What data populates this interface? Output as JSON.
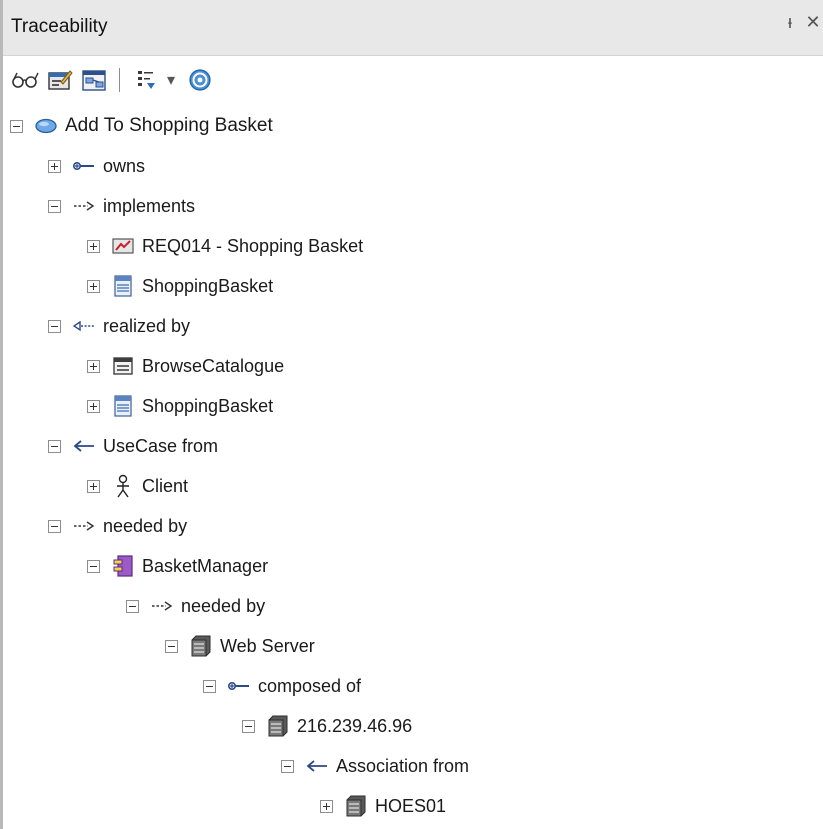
{
  "window": {
    "title": "Traceability",
    "pin_glyph": "ᵼ",
    "close_glyph": "✕"
  },
  "toolbar": {
    "icons": [
      "glasses-icon",
      "properties-icon",
      "diagram-icon",
      "filter-icon",
      "dropdown-arrow-icon",
      "help-icon"
    ],
    "dropdown_glyph": "▾"
  },
  "tree": {
    "root": {
      "label": "Add To Shopping Basket",
      "icon": "usecase-icon",
      "expanded": true
    },
    "nodes": [
      {
        "label": "owns",
        "icon": "owns-connector-icon",
        "expanded": false
      },
      {
        "label": "implements",
        "icon": "dependency-arrow-icon",
        "expanded": true
      },
      {
        "label": "REQ014 - Shopping Basket",
        "icon": "requirement-icon",
        "expanded": false
      },
      {
        "label": "ShoppingBasket",
        "icon": "class-icon",
        "expanded": false
      },
      {
        "label": "realized by",
        "icon": "realization-arrow-icon",
        "expanded": true
      },
      {
        "label": "BrowseCatalogue",
        "icon": "screen-icon",
        "expanded": false
      },
      {
        "label": "ShoppingBasket",
        "icon": "class-icon",
        "expanded": false
      },
      {
        "label": "UseCase from",
        "icon": "association-arrow-icon",
        "expanded": true
      },
      {
        "label": "Client",
        "icon": "actor-icon",
        "expanded": false
      },
      {
        "label": "needed by",
        "icon": "dependency-arrow-icon",
        "expanded": true
      },
      {
        "label": "BasketManager",
        "icon": "component-icon",
        "expanded": true
      },
      {
        "label": "needed by",
        "icon": "dependency-arrow-icon",
        "expanded": true
      },
      {
        "label": "Web Server",
        "icon": "node-icon",
        "expanded": true
      },
      {
        "label": "composed of",
        "icon": "owns-connector-icon",
        "expanded": true
      },
      {
        "label": "216.239.46.96",
        "icon": "node-icon",
        "expanded": true
      },
      {
        "label": "Association from",
        "icon": "association-arrow-icon",
        "expanded": true
      },
      {
        "label": "HOES01",
        "icon": "node-icon",
        "expanded": false
      }
    ]
  }
}
